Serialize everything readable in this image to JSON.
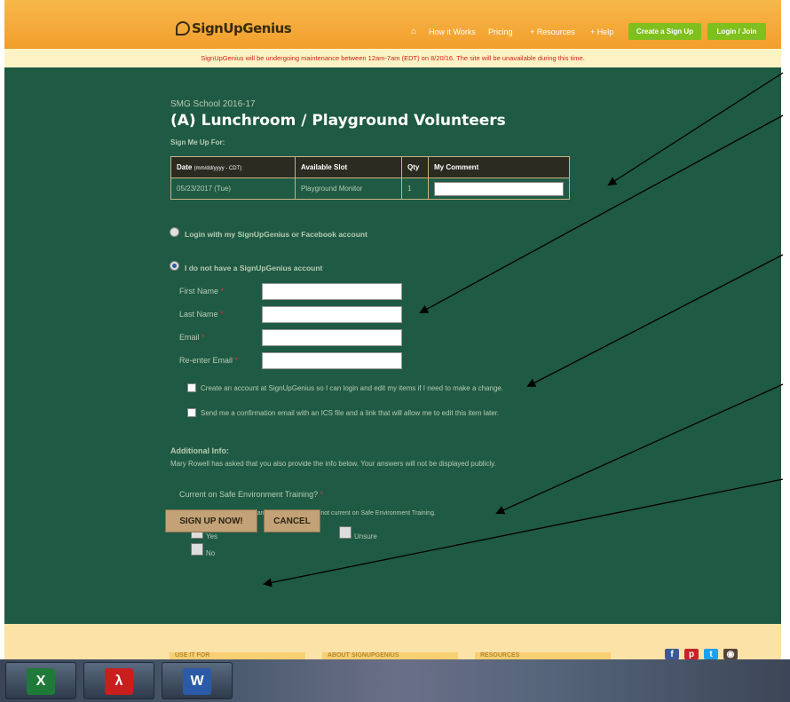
{
  "header": {
    "logo": "SignUpGenius",
    "nav": {
      "how_it_works": "How it Works",
      "pricing": "Pricing",
      "resources": "+ Resources",
      "help": "+ Help"
    },
    "create_button": "Create a Sign Up",
    "login_button": "Login / Join"
  },
  "notice": "SignUpGenius will be undergoing maintenance between 12am-7am (EDT) on 8/20/16. The site will be unavailable during this time.",
  "signup": {
    "group": "SMG School 2016-17",
    "title": "(A) Lunchroom / Playground Volunteers",
    "sign_me_up_for": "Sign Me Up For:"
  },
  "slots_table": {
    "headers": {
      "date": "Date",
      "date_format": "(mm/dd/yyyy - CDT)",
      "slot": "Available Slot",
      "qty": "Qty",
      "comment": "My Comment"
    },
    "rows": [
      {
        "date": "05/23/2017 (Tue)",
        "slot": "Playground Monitor",
        "qty": "1",
        "comment": ""
      }
    ]
  },
  "account": {
    "login_option": "Login with my SignUpGenius or Facebook account",
    "no_account_option": "I do not have a SignUpGenius account"
  },
  "form": {
    "first_name_label": "First Name",
    "last_name_label": "Last Name",
    "email_label": "Email",
    "reenter_email_label": "Re-enter Email",
    "required_mark": "*",
    "first_name_value": "",
    "last_name_value": "",
    "email_value": "",
    "reenter_email_value": "",
    "create_account_option": "Create an account at SignUpGenius so I can login and edit my items if I need to make a change.",
    "confirmation_option": "Send me a confirmation email with an ICS file and a link that will allow me to edit this item later."
  },
  "additional": {
    "heading": "Additional Info:",
    "description": "Mary Rowell has asked that you also provide the info below. Your answers will not be displayed publicly.",
    "question": "Current on Safe Environment Training?",
    "note": "You may not volunteer in any capacity if you are not current on Safe Environment Training.",
    "options": {
      "yes": "Yes",
      "unsure": "Unsure",
      "no": "No"
    }
  },
  "actions": {
    "submit": "SIGN UP NOW!",
    "cancel": "CANCEL"
  },
  "footer": {
    "col1": "USE IT FOR",
    "col2": "ABOUT SIGNUPGENIUS",
    "col3": "RESOURCES"
  },
  "colors": {
    "header": "#f29e2c",
    "main_bg": "#1f5a44",
    "accent_green": "#7fbf1e",
    "button_tan": "#c2a276",
    "notice_text": "#d21d1d"
  },
  "icons": {
    "logo": "signupgenius-logo-icon",
    "home": "home-icon",
    "social": [
      "facebook-icon",
      "pinterest-icon",
      "twitter-icon",
      "instagram-icon"
    ],
    "taskbar": [
      "excel-icon",
      "acrobat-icon",
      "word-icon"
    ]
  }
}
